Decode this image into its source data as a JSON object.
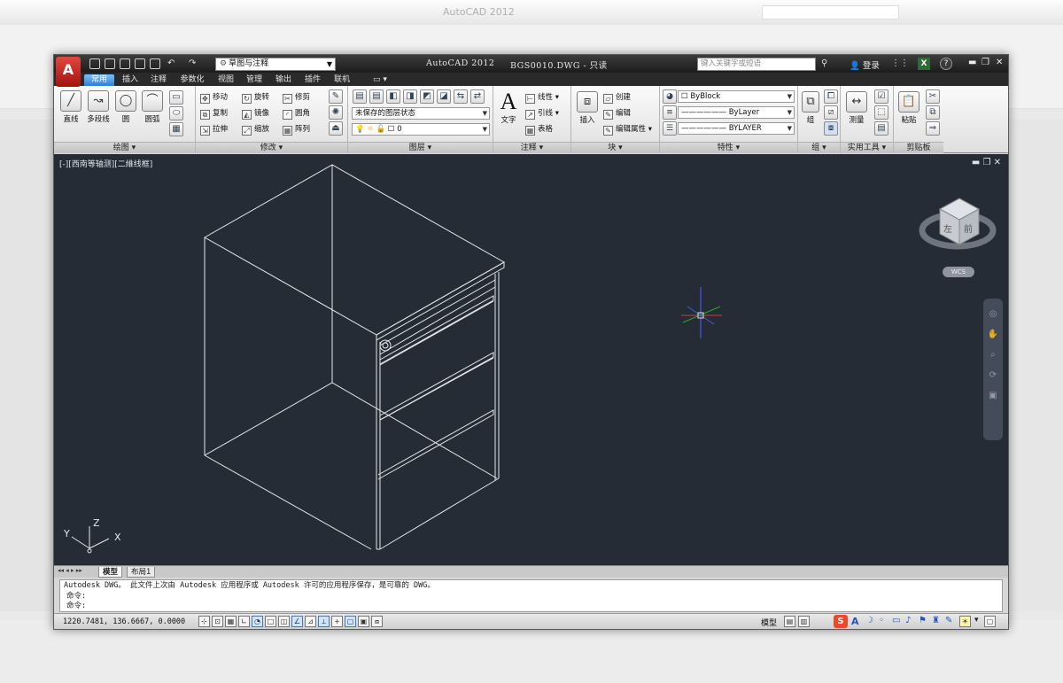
{
  "window": {
    "app_title": "AutoCAD 2012",
    "file_title": "BGS0010.DWG - 只读",
    "workspace": "草图与注释",
    "search_placeholder": "键入关键字或短语",
    "login": "登录",
    "help": "?"
  },
  "tabs": [
    "常用",
    "插入",
    "注释",
    "参数化",
    "视图",
    "管理",
    "输出",
    "插件",
    "联机",
    "▭ ▾"
  ],
  "active_tab": "常用",
  "panels": {
    "draw": {
      "title": "绘图 ▾",
      "line": "直线",
      "polyline": "多段线",
      "circle": "圆",
      "arc": "圆弧"
    },
    "modify": {
      "title": "修改 ▾",
      "move": "移动",
      "rotate": "旋转",
      "trim": "修剪",
      "copy": "复制",
      "mirror": "镜像",
      "fillet": "圆角",
      "stretch": "拉伸",
      "scale": "缩放",
      "array": "阵列"
    },
    "layers": {
      "title": "图层 ▾",
      "state": "未保存的图层状态",
      "current_layer": "0"
    },
    "annotation": {
      "title": "注释 ▾",
      "text": "文字",
      "linear": "线性",
      "leader": "引线",
      "table": "表格"
    },
    "block": {
      "title": "块 ▾",
      "insert": "插入",
      "create": "创建",
      "edit": "编辑",
      "edit_attr": "编辑属性"
    },
    "properties": {
      "title": "特性 ▾",
      "color": "ByBlock",
      "linetype": "ByLayer",
      "lineweight": "BYLAYER"
    },
    "groups": {
      "title": "组 ▾",
      "group": "组"
    },
    "utilities": {
      "title": "实用工具 ▾",
      "measure": "测量"
    },
    "clipboard": {
      "title": "剪贴板",
      "paste": "粘贴"
    }
  },
  "viewport": {
    "label": "[-][西南等轴测][二維线框]",
    "controls": "▬ ❐ ✕",
    "viewcube_left": "左",
    "viewcube_front": "前",
    "wcs": "WCS",
    "ucs_x": "X",
    "ucs_y": "Y",
    "ucs_z": "Z"
  },
  "layout_tabs": [
    "模型",
    "布局1"
  ],
  "layout_nav": "◂◂ ◂ ▸ ▸▸",
  "command_lines": [
    "Autodesk DWG。  此文件上次由 Autodesk 应用程序或 Autodesk 许可的应用程序保存，是可靠的 DWG。",
    "命令:",
    "命令:"
  ],
  "status": {
    "coords": "1220.7481, 136.6667, 0.0000",
    "model": "模型"
  },
  "colors": {
    "title_bg": "#1c1c1c",
    "viewport_bg": "#252c36",
    "active_tab": "#2f7fd6",
    "drawing_line": "#e6e8ea"
  }
}
